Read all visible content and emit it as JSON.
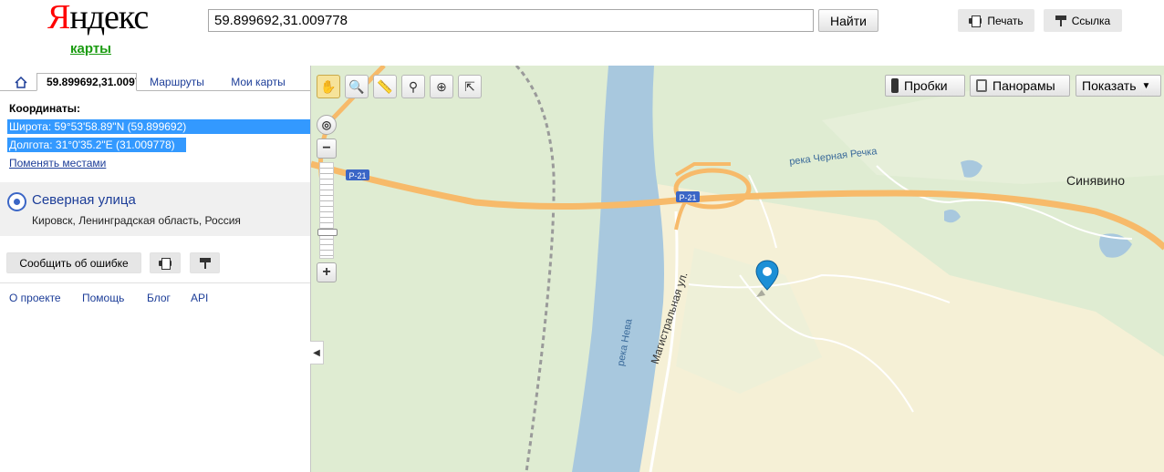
{
  "header": {
    "logo_first": "Я",
    "logo_rest": "ндекс",
    "logo_sub": "карты",
    "search_value": "59.899692,31.009778",
    "find_label": "Найти",
    "print_label": "Печать",
    "link_label": "Ссылка"
  },
  "sidebar": {
    "tabs": {
      "coords": "59.899692,31.009778",
      "routes": "Маршруты",
      "mymaps": "Мои карты"
    },
    "coords_title": "Координаты:",
    "lat_line": "Широта: 59°53'58.89\"N (59.899692)",
    "lon_line": "Долгота: 31°0'35.2\"E (31.009778)",
    "swap_label": "Поменять местами",
    "result": {
      "title": "Северная улица",
      "subtitle": "Кировск, Ленинградская область, Россия"
    },
    "report_label": "Сообщить об ошибке",
    "footer_links": [
      "О проекте",
      "Помощь",
      "Блог",
      "API"
    ]
  },
  "map": {
    "traffic_label": "Пробки",
    "panorama_label": "Панорамы",
    "show_label": "Показать",
    "labels": {
      "sinyavino": "Синявино",
      "chernaya_rechka": "река Черная Речка",
      "neva": "река Нева",
      "magistralnaya": "Магистральная ул.",
      "road": "Р-21"
    },
    "colors": {
      "land": "#dfecd2",
      "river": "#a8c8de",
      "road": "#f7ba6a",
      "urban": "#f5f0d6",
      "marker": "#1c8fd6"
    }
  }
}
